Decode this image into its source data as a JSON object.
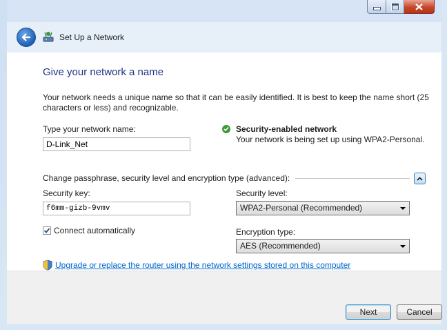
{
  "window": {
    "title": "Set Up a Network",
    "caption_buttons": {
      "minimize": "minimize-icon",
      "maximize": "maximize-icon",
      "close": "close-icon"
    }
  },
  "page": {
    "heading": "Give your network a name",
    "intro": "Your network needs a unique name so that it can be easily identified. It is best to keep the name short (25 characters or less) and recognizable."
  },
  "network_name": {
    "label": "Type your network name:",
    "value": "D-Link_Net"
  },
  "security_status": {
    "title": "Security-enabled network",
    "description": "Your network is being set up using WPA2-Personal."
  },
  "advanced": {
    "label": "Change passphrase, security level and encryption type (advanced):",
    "expanded": true
  },
  "security_key": {
    "label": "Security key:",
    "value": "f6mm-gizb-9vmv"
  },
  "security_level": {
    "label": "Security level:",
    "selected": "WPA2-Personal (Recommended)"
  },
  "connect_automatically": {
    "label": "Connect automatically",
    "checked": true
  },
  "encryption_type": {
    "label": "Encryption type:",
    "selected": "AES (Recommended)"
  },
  "upgrade_link": "Upgrade or replace the router using the network settings stored on this computer",
  "footer": {
    "next_label": "Next",
    "cancel_label": "Cancel"
  },
  "colors": {
    "heading": "#1e3287",
    "link": "#0066cc",
    "secure": "#3d9b37"
  }
}
